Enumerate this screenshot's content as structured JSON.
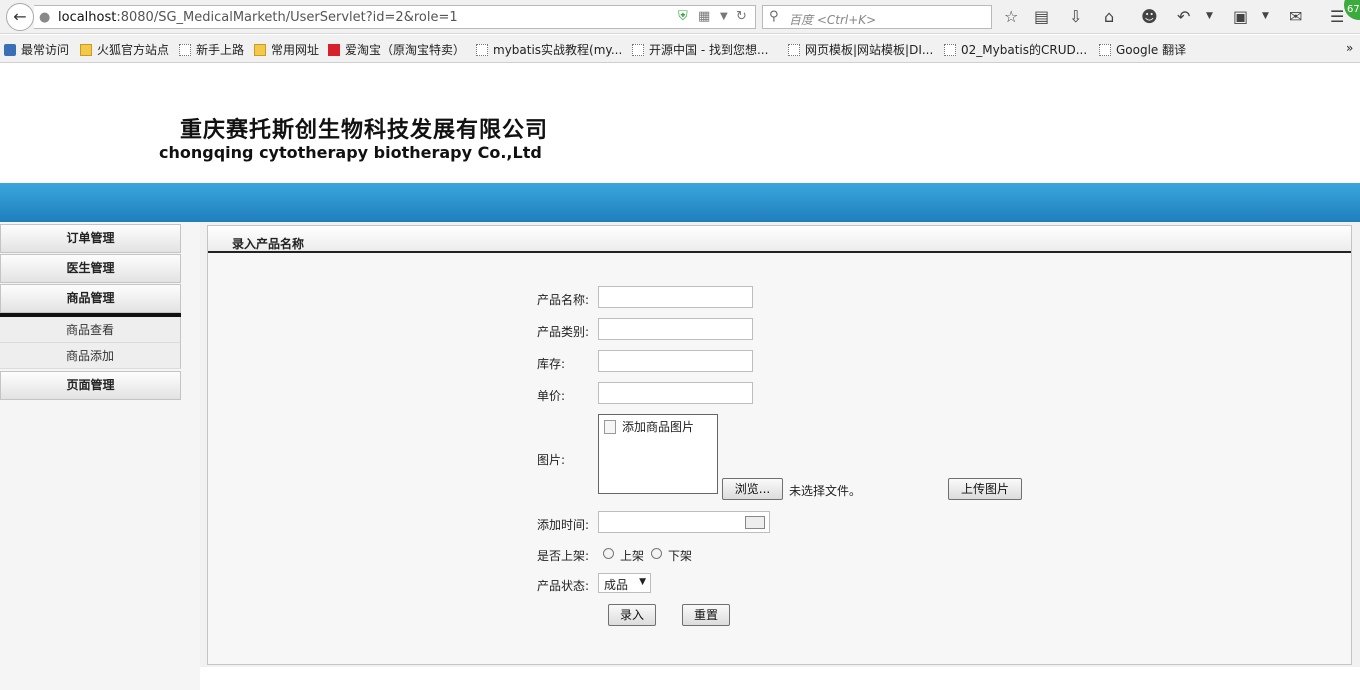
{
  "browser": {
    "url_host": "localhost",
    "url_rest": ":8080/SG_MedicalMarketh/UserServlet?id=2&role=1",
    "search_placeholder": "百度 <Ctrl+K>",
    "badge": "67",
    "bookmarks": [
      "最常访问",
      "火狐官方站点",
      "新手上路",
      "常用网址",
      "爱淘宝（原淘宝特卖）",
      "mybatis实战教程(my...",
      "开源中国 - 找到您想...",
      "网页模板|网站模板|DI...",
      "02_Mybatis的CRUD...",
      "Google 翻译"
    ],
    "overflow": "»"
  },
  "header": {
    "company_cn": "重庆赛托斯创生物科技发展有限公司",
    "company_en": "chongqing cytotherapy biotherapy Co.,Ltd"
  },
  "sidebar": {
    "menus": [
      "订单管理",
      "医生管理",
      "商品管理"
    ],
    "submenus": [
      "商品查看",
      "商品添加"
    ],
    "last_menu": "页面管理"
  },
  "form": {
    "title": "录入产品名称",
    "name_label": "产品名称:",
    "category_label": "产品类别:",
    "stock_label": "库存:",
    "price_label": "单价:",
    "image_label": "图片:",
    "image_placeholder": "添加商品图片",
    "browse_button": "浏览...",
    "no_file": "未选择文件。",
    "upload_button": "上传图片",
    "added_time_label": "添加时间:",
    "on_shelf_label": "是否上架:",
    "on_shelf_yes": "上架",
    "on_shelf_no": "下架",
    "status_label": "产品状态:",
    "status_value": "成品",
    "submit_button": "录入",
    "reset_button": "重置"
  }
}
